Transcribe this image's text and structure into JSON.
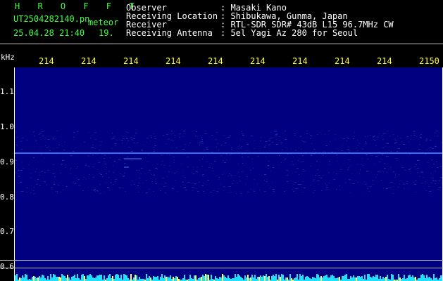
{
  "title": "H R O F F T",
  "filename": "UT2504282140.pn",
  "event_label": "meteor",
  "timestamp": "25.04.28 21:40",
  "count": "19.",
  "info": [
    {
      "label": "Observer",
      "value": ": Masaki Kano"
    },
    {
      "label": "Receiving Location",
      "value": ": Shibukawa, Gunma, Japan"
    },
    {
      "label": "Receiver",
      "value": ": RTL-SDR SDR# 43dB L15 96.7MHz CW"
    },
    {
      "label": "Receiving Antenna",
      "value": ": 5el Yagi Az 280 for Seoul"
    }
  ],
  "y_unit": "kHz",
  "y_ticks": [
    "1.1",
    "1.0",
    "0.9",
    "0.8",
    "0.7",
    "0.6"
  ],
  "x_ticks": [
    "214",
    "214",
    "214",
    "214",
    "214",
    "214",
    "214",
    "214",
    "214",
    "2150"
  ],
  "colors": {
    "background": "#000000",
    "plot_bg": "#000080",
    "title": "#40ff40",
    "header": "#ffffff",
    "tick": "#ffff40",
    "signal": "#40a0ff"
  }
}
